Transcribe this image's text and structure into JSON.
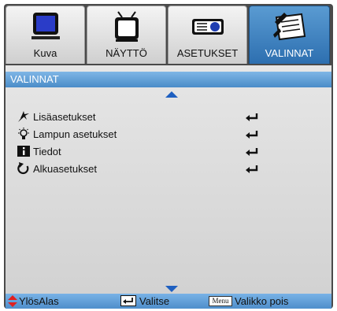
{
  "tabs": [
    {
      "label": "Kuva",
      "icon": "monitor-icon"
    },
    {
      "label": "NÄYTTÖ",
      "icon": "tv-icon"
    },
    {
      "label": "ASETUKSET",
      "icon": "projector-icon"
    },
    {
      "label": "VALINNAT",
      "icon": "options-notepad-icon",
      "active": true
    }
  ],
  "panel": {
    "title": "VALINNAT",
    "items": [
      {
        "label": "Lisäasetukset",
        "icon": "advanced-icon"
      },
      {
        "label": "Lampun asetukset",
        "icon": "lamp-icon"
      },
      {
        "label": "Tiedot",
        "icon": "info-icon"
      },
      {
        "label": "Alkuasetukset",
        "icon": "reset-icon"
      }
    ]
  },
  "footer": {
    "updown_label": "YlösAlas",
    "select_label": "Valitse",
    "menu_key": "Menu",
    "exit_label": "Valikko pois"
  },
  "colors": {
    "accent": "#4a8cc8",
    "frame": "#4a4a4a",
    "arrow": "#1e5fc0",
    "updown_icon": "#e02020"
  }
}
